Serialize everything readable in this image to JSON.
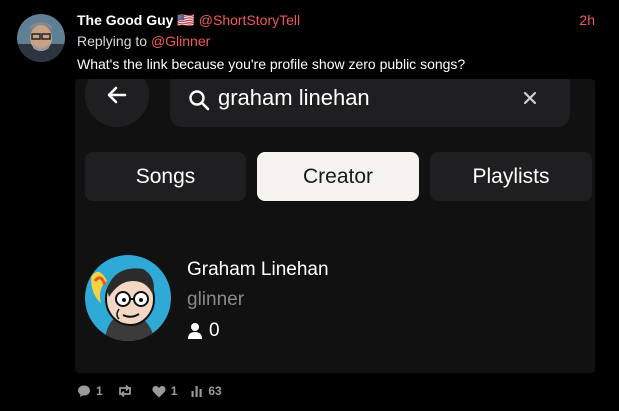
{
  "tweet": {
    "display_name": "The Good Guy 🇺🇸",
    "handle": "@ShortStoryTell",
    "timestamp": "2h",
    "replying_prefix": "Replying to",
    "replying_mention": "@Glinner",
    "text": "What's the link because you're profile show zero public songs?"
  },
  "embed": {
    "search": {
      "query": "graham linehan",
      "icon": "search-icon",
      "clear_icon": "close-icon",
      "back_icon": "arrow-left-icon"
    },
    "tabs": [
      {
        "label": "Songs",
        "active": false
      },
      {
        "label": "Creator",
        "active": true
      },
      {
        "label": "Playlists",
        "active": false
      }
    ],
    "result": {
      "name": "Graham Linehan",
      "handle": "glinner",
      "followers": "0"
    }
  },
  "actions": {
    "replies": "1",
    "retweets": "",
    "likes": "1",
    "views": "63"
  },
  "colors": {
    "accent": "#f15a5a",
    "background": "#000000",
    "panel": "#111112",
    "control": "#1f1f21",
    "active_tab": "#f6f3ef"
  }
}
